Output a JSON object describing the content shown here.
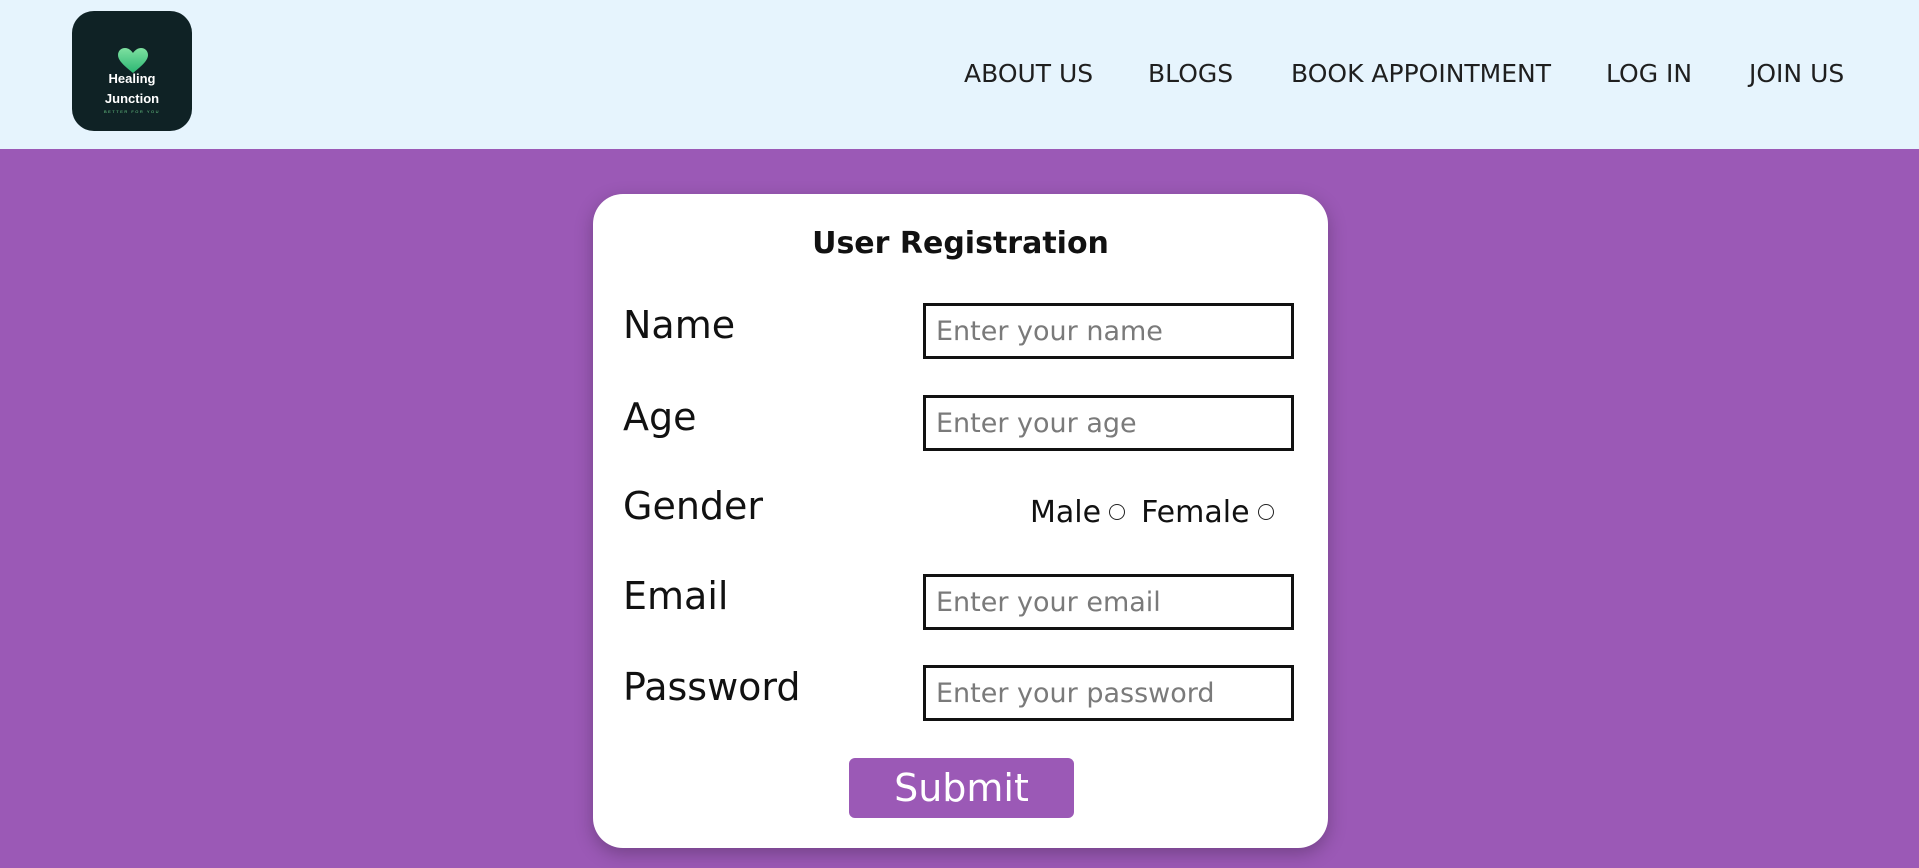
{
  "header": {
    "logo": {
      "line1": "Healing",
      "line2": "Junction",
      "tagline": "BETTER FOR YOU"
    },
    "nav": [
      {
        "label": "ABOUT US"
      },
      {
        "label": "BLOGS"
      },
      {
        "label": "BOOK APPOINTMENT"
      },
      {
        "label": "LOG IN"
      },
      {
        "label": "JOIN US"
      }
    ]
  },
  "form": {
    "title": "User Registration",
    "name": {
      "label": "Name",
      "placeholder": "Enter your name"
    },
    "age": {
      "label": "Age",
      "placeholder": "Enter your age"
    },
    "gender": {
      "label": "Gender",
      "options": [
        "Male",
        "Female"
      ]
    },
    "email": {
      "label": "Email",
      "placeholder": "Enter your email"
    },
    "password": {
      "label": "Password",
      "placeholder": "Enter your password"
    },
    "submit_label": "Submit"
  },
  "colors": {
    "header_bg": "#e6f4fd",
    "page_bg": "#9b59b6",
    "logo_bg": "#0f2225",
    "card_bg": "#ffffff",
    "button_bg": "#9b59b6"
  }
}
